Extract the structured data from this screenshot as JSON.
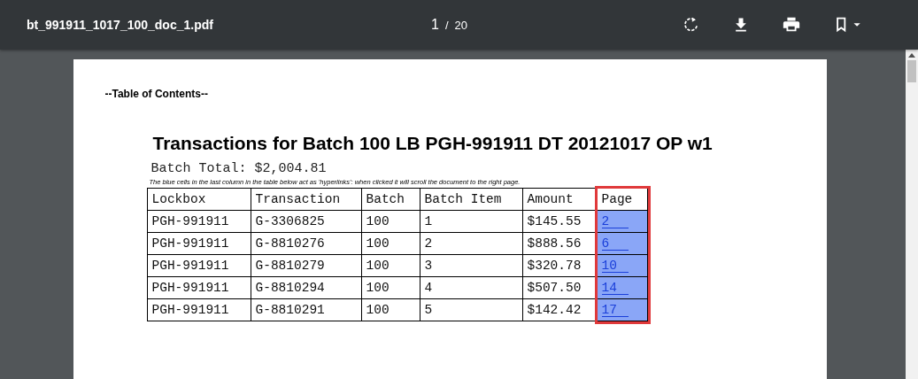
{
  "toolbar": {
    "file_name": "bt_991911_1017_100_doc_1.pdf",
    "current_page": "1",
    "page_separator": "/",
    "total_pages": "20"
  },
  "document": {
    "toc_heading": "--Table of Contents--",
    "title": "Transactions for Batch 100 LB PGH-991911 DT 20121017 OP w1",
    "batch_total": "Batch Total: $2,004.81",
    "note": "The blue cells in the last column in the table below act as 'hyperlinks': when clicked it will scroll the document to the right page.",
    "table": {
      "columns": [
        {
          "label": "Lockbox",
          "kind": "text",
          "highlighted": false
        },
        {
          "label": "Transaction",
          "kind": "text",
          "highlighted": false
        },
        {
          "label": "Batch",
          "kind": "text",
          "highlighted": false
        },
        {
          "label": "Batch Item",
          "kind": "text",
          "highlighted": false
        },
        {
          "label": "Amount",
          "kind": "text",
          "highlighted": false
        },
        {
          "label": "Page",
          "kind": "link",
          "highlighted": true
        }
      ],
      "rows": [
        [
          "PGH-991911",
          "G-3306825",
          "100",
          "1",
          "$145.55",
          "2"
        ],
        [
          "PGH-991911",
          "G-8810276",
          "100",
          "2",
          "$888.56",
          "6"
        ],
        [
          "PGH-991911",
          "G-8810279",
          "100",
          "3",
          "$320.78",
          "10"
        ],
        [
          "PGH-991911",
          "G-8810294",
          "100",
          "4",
          "$507.50",
          "14"
        ],
        [
          "PGH-991911",
          "G-8810291",
          "100",
          "5",
          "$142.42",
          "17"
        ]
      ]
    }
  }
}
